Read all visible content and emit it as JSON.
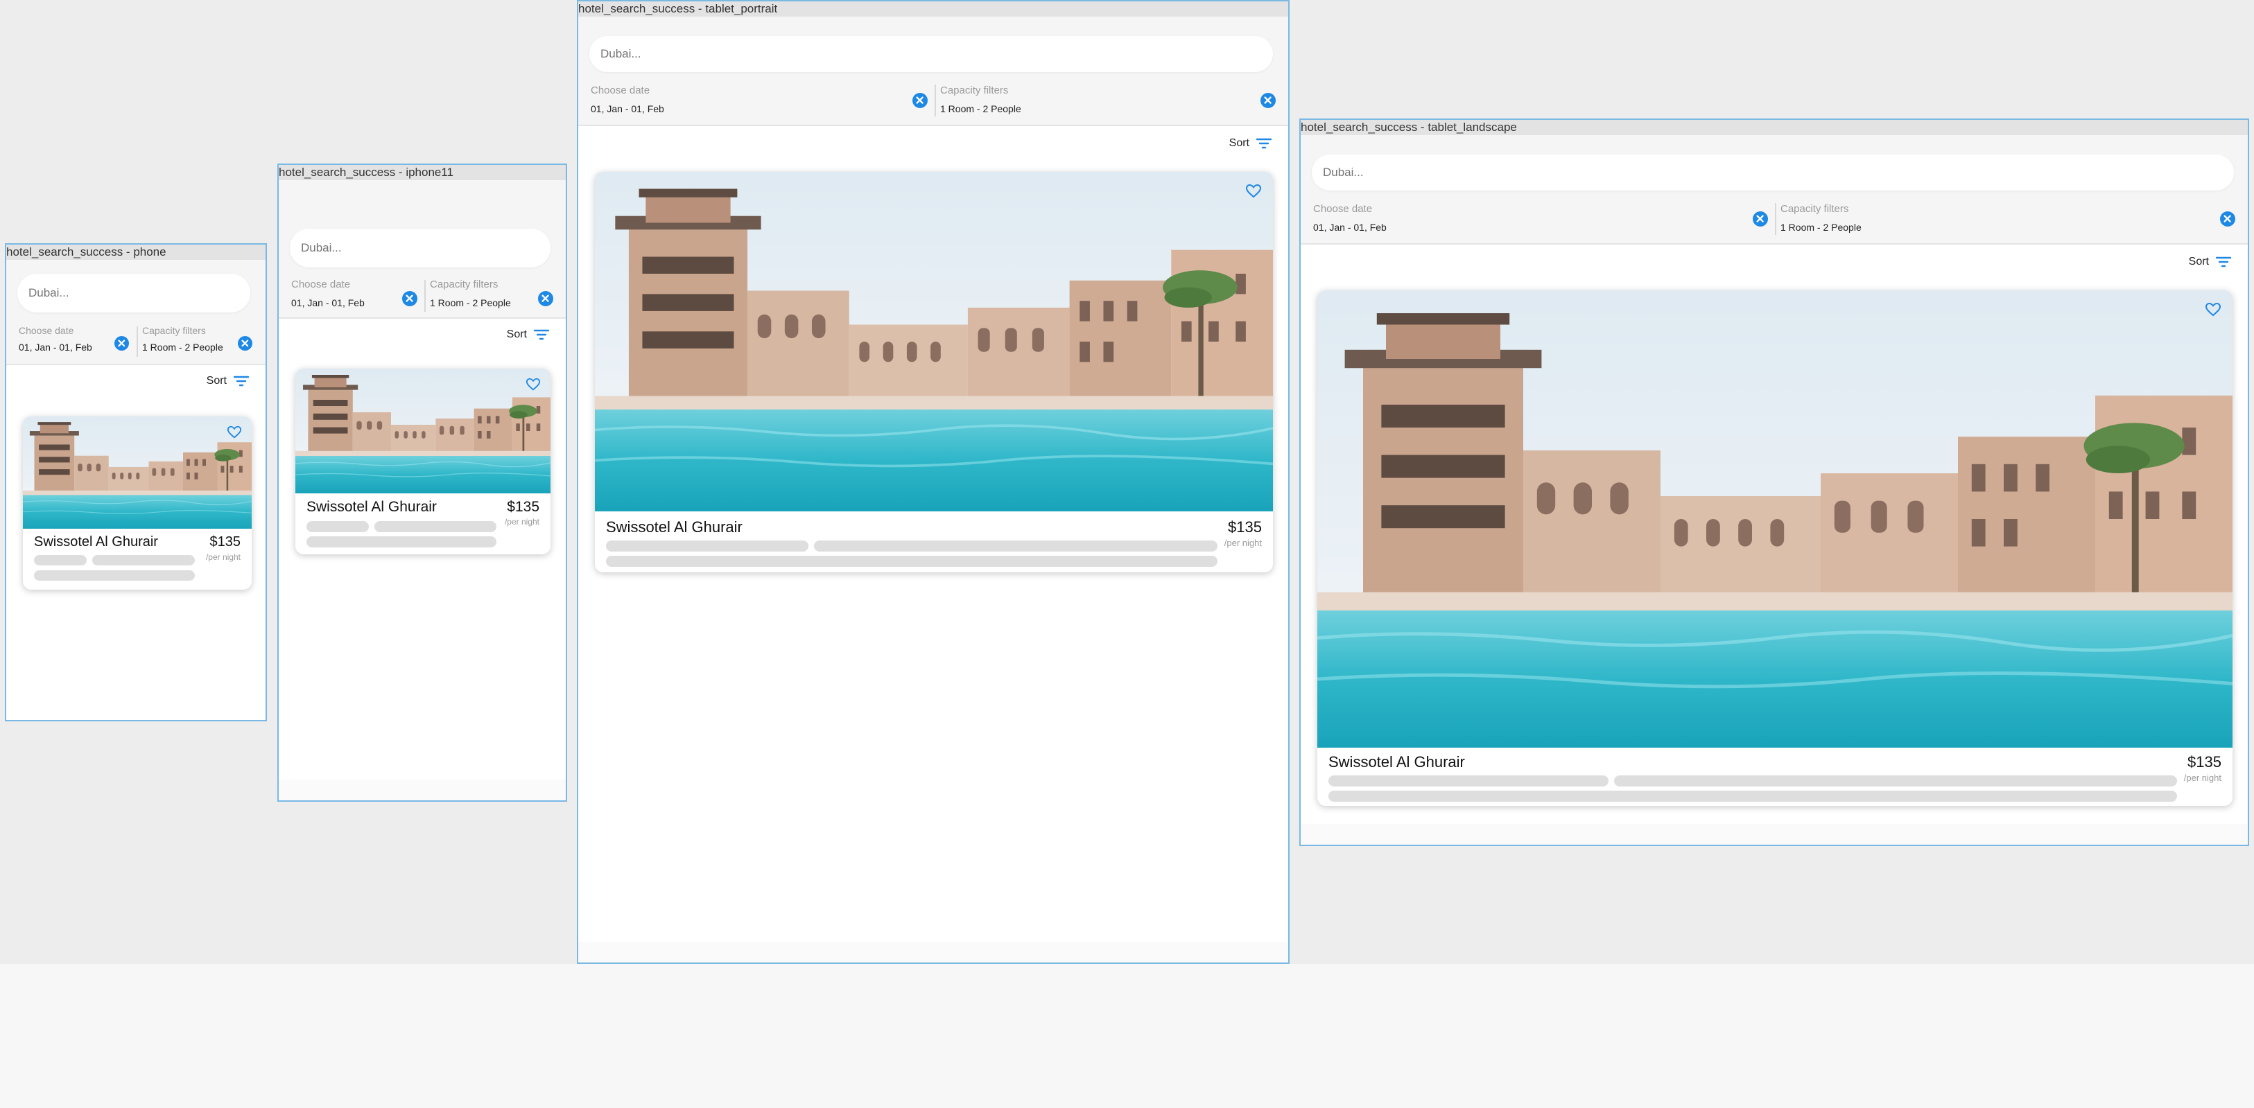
{
  "colors": {
    "accent": "#1e88e5",
    "frame_border": "#7ab9e4",
    "background": "#ededed",
    "water": "#2fb7c9"
  },
  "icons": {
    "clear": "cancel-circle-icon",
    "sort": "sort-lines-icon",
    "favorite": "heart-outline-icon"
  },
  "frames": [
    {
      "label": "hotel_search_success - phone",
      "search_placeholder": "Dubai...",
      "date_filter": {
        "label": "Choose date",
        "value": "01, Jan - 01, Feb"
      },
      "capacity_filter": {
        "label": "Capacity filters",
        "value": "1 Room - 2 People"
      },
      "sort_label": "Sort",
      "card": {
        "hotel_name": "Swissotel Al Ghurair",
        "price": "$135",
        "per_night": "/per night"
      }
    },
    {
      "label": "hotel_search_success - iphone11",
      "search_placeholder": "Dubai...",
      "date_filter": {
        "label": "Choose date",
        "value": "01, Jan - 01, Feb"
      },
      "capacity_filter": {
        "label": "Capacity filters",
        "value": "1 Room - 2 People"
      },
      "sort_label": "Sort",
      "card": {
        "hotel_name": "Swissotel Al Ghurair",
        "price": "$135",
        "per_night": "/per night"
      }
    },
    {
      "label": "hotel_search_success - tablet_portrait",
      "search_placeholder": "Dubai...",
      "date_filter": {
        "label": "Choose date",
        "value": "01, Jan - 01, Feb"
      },
      "capacity_filter": {
        "label": "Capacity filters",
        "value": "1 Room - 2 People"
      },
      "sort_label": "Sort",
      "card": {
        "hotel_name": "Swissotel Al Ghurair",
        "price": "$135",
        "per_night": "/per night"
      }
    },
    {
      "label": "hotel_search_success - tablet_landscape",
      "search_placeholder": "Dubai...",
      "date_filter": {
        "label": "Choose date",
        "value": "01, Jan - 01, Feb"
      },
      "capacity_filter": {
        "label": "Capacity filters",
        "value": "1 Room - 2 People"
      },
      "sort_label": "Sort",
      "card": {
        "hotel_name": "Swissotel Al Ghurair",
        "price": "$135",
        "per_night": "/per night"
      }
    }
  ]
}
